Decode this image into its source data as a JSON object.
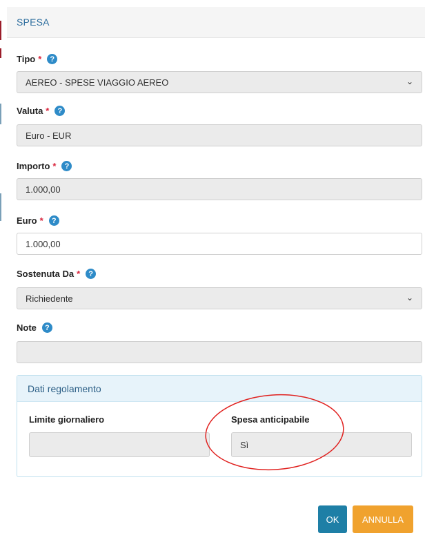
{
  "header": {
    "title": "SPESA"
  },
  "fields": {
    "tipo": {
      "label": "Tipo",
      "value": "AEREO - SPESE VIAGGIO AEREO"
    },
    "valuta": {
      "label": "Valuta",
      "value": "Euro - EUR"
    },
    "importo": {
      "label": "Importo",
      "value": "1.000,00"
    },
    "euro": {
      "label": "Euro",
      "value": "1.000,00"
    },
    "sostenuta": {
      "label": "Sostenuta Da",
      "value": "Richiedente"
    },
    "note": {
      "label": "Note",
      "value": ""
    }
  },
  "required_mark": "*",
  "help_glyph": "?",
  "panel": {
    "title": "Dati regolamento",
    "limite": {
      "label": "Limite giornaliero",
      "value": ""
    },
    "anticipabile": {
      "label": "Spesa anticipabile",
      "value": "Sì"
    }
  },
  "buttons": {
    "ok": "OK",
    "cancel": "ANNULLA"
  },
  "colors": {
    "accent": "#1e7fa6",
    "cancel": "#f0a22e",
    "required": "#d9263e",
    "help": "#2e8bc8",
    "annotation": "#e0201e"
  }
}
